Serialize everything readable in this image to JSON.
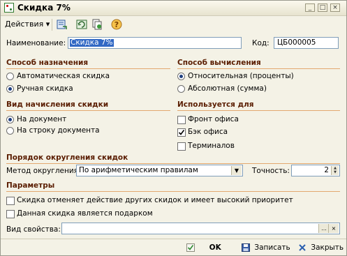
{
  "window": {
    "title": "Скидка 7%",
    "controls": {
      "minimize": "_",
      "maximize": "□",
      "close": "×"
    }
  },
  "toolbar": {
    "actions_label": "Действия",
    "actions_arrow": "▾",
    "help_glyph": "?"
  },
  "name_row": {
    "name_label": "Наименование:",
    "name_value": "Скидка 7%",
    "code_label": "Код:",
    "code_value": "ЦБ000005"
  },
  "assignment": {
    "title": "Способ назначения",
    "options": [
      "Автоматическая скидка",
      "Ручная скидка"
    ],
    "selected": 1
  },
  "calculation": {
    "title": "Способ вычисления",
    "options": [
      "Относительная (проценты)",
      "Абсолютная (сумма)"
    ],
    "selected": 0
  },
  "accrual": {
    "title": "Вид начисления скидки",
    "options": [
      "На документ",
      "На строку документа"
    ],
    "selected": 0
  },
  "used_for": {
    "title": "Используется для",
    "items": [
      {
        "label": "Фронт офиса",
        "checked": false
      },
      {
        "label": "Бэк офиса",
        "checked": true
      },
      {
        "label": "Терминалов",
        "checked": false
      }
    ]
  },
  "rounding": {
    "title": "Порядок округления скидок",
    "method_label": "Метод округления:",
    "method_value": "По арифметическим правилам",
    "precision_label": "Точность:",
    "precision_value": "2"
  },
  "params": {
    "title": "Параметры",
    "checks": [
      {
        "label": "Скидка отменяет действие других скидок и имеет высокий приоритет",
        "checked": false
      },
      {
        "label": "Данная скидка является подарком",
        "checked": false
      }
    ],
    "property_label": "Вид свойства:",
    "property_value": "",
    "select_glyph": "...",
    "clear_glyph": "×"
  },
  "footer": {
    "ok_label": "OK",
    "save_label": "Записать",
    "close_label": "Закрыть"
  },
  "colors": {
    "section_title": "#5a1d00",
    "section_rule": "#e3a86f",
    "selection": "#3168c4",
    "window_bg": "#f4f2e6"
  }
}
